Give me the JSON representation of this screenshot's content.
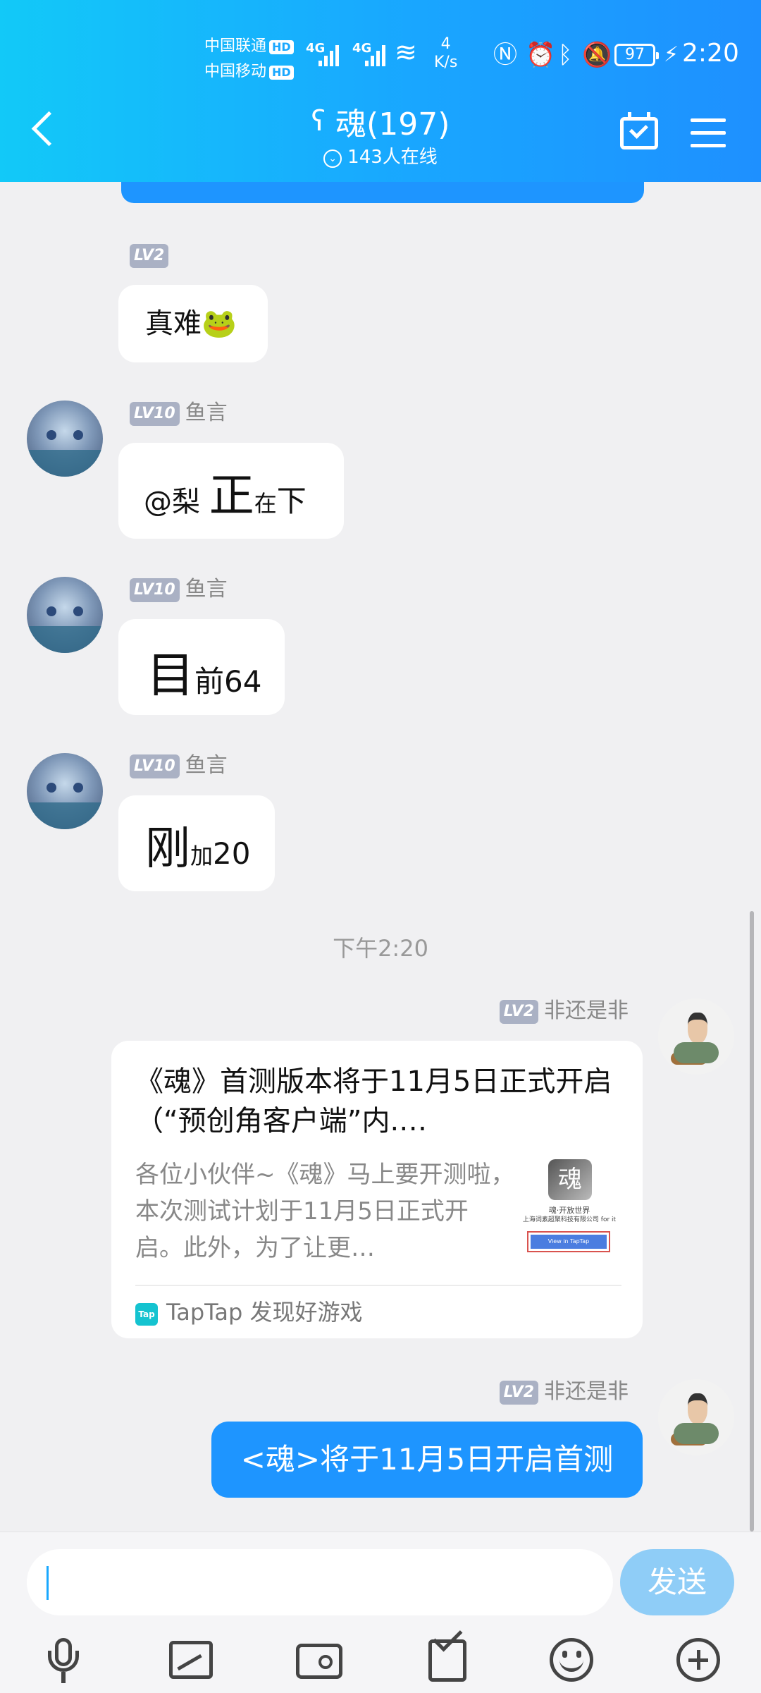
{
  "status_bar": {
    "carrier1": "中国联通",
    "carrier2": "中国移动",
    "hd": "HD",
    "network1": "4G",
    "network2": "4G",
    "speed_value": "4",
    "speed_unit": "K/s",
    "battery": "97",
    "time": "2:20"
  },
  "header": {
    "title": "魂(197)",
    "online": "143人在线"
  },
  "messages": [
    {
      "level": "LV2",
      "sender": "",
      "text": "真难🐸"
    },
    {
      "level": "LV10",
      "sender": "鱼言",
      "text_big": "正",
      "text_pre": "@梨 ",
      "text_small": "在",
      "text_mid": "下"
    },
    {
      "level": "LV10",
      "sender": "鱼言",
      "text_big": "目",
      "text_small": "前64"
    },
    {
      "level": "LV10",
      "sender": "鱼言",
      "text_big": "刚",
      "text_small": "加",
      "text_mid": "20"
    }
  ],
  "time_label": "下午2:20",
  "share_card": {
    "level": "LV2",
    "sender": "非还是非",
    "title": "《魂》首测版本将于11月5日正式开启（“预创角客户端”内.…",
    "description": "各位小伙伴~《魂》马上要开测啦，本次测试计划于11月5日正式开启。此外，为了让更…",
    "thumb_logo": "魂",
    "thumb_line1": "魂·开放世界",
    "thumb_line2": "上海词素超聚科技有限公司 for it",
    "thumb_button": "View in TapTap",
    "source_icon": "Tap",
    "source": "TapTap 发现好游戏"
  },
  "last_message": {
    "level": "LV2",
    "sender": "非还是非",
    "text": "<魂>将于11月5日开启首测"
  },
  "input": {
    "placeholder": "",
    "send_label": "发送"
  },
  "colors": {
    "header_start": "#12c9f8",
    "header_end": "#1e90ff",
    "bubble_blue": "#1e95ff",
    "send_button": "#8fcdf7"
  },
  "icons": [
    "back-icon",
    "ear-icon",
    "calendar-check-icon",
    "menu-icon",
    "mic-icon",
    "image-icon",
    "camera-icon",
    "envelope-icon",
    "emoji-icon",
    "plus-icon"
  ]
}
